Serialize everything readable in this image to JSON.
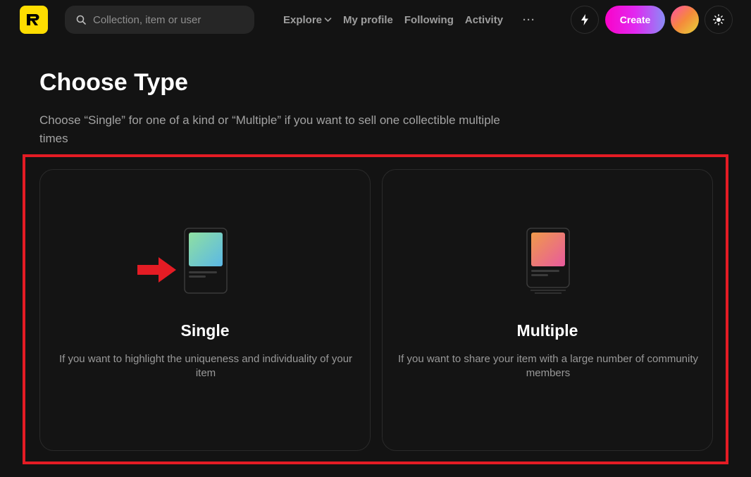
{
  "header": {
    "logo_icon": "rarible-r-logo",
    "search": {
      "placeholder": "Collection, item or user",
      "value": ""
    },
    "nav": [
      {
        "label": "Explore",
        "has_dropdown": true
      },
      {
        "label": "My profile"
      },
      {
        "label": "Following"
      },
      {
        "label": "Activity"
      }
    ],
    "more_label": "···",
    "bolt_icon": "lightning-icon",
    "create_label": "Create",
    "theme_icon": "sun-icon"
  },
  "main": {
    "title": "Choose Type",
    "description": "Choose “Single” for one of a kind or “Multiple” if you want to sell one collectible multiple times",
    "options": [
      {
        "label": "Single",
        "description": "If you want to highlight the uniqueness and individuality of your item",
        "gradient": [
          "#8fe0a1",
          "#5bb8e6"
        ]
      },
      {
        "label": "Multiple",
        "description": "If you want to share your item with a large number of community members",
        "gradient": [
          "#f09a4a",
          "#e85a9e"
        ]
      }
    ]
  },
  "annotations": {
    "highlight_color": "#e41c24",
    "arrow_color": "#e41c24"
  }
}
